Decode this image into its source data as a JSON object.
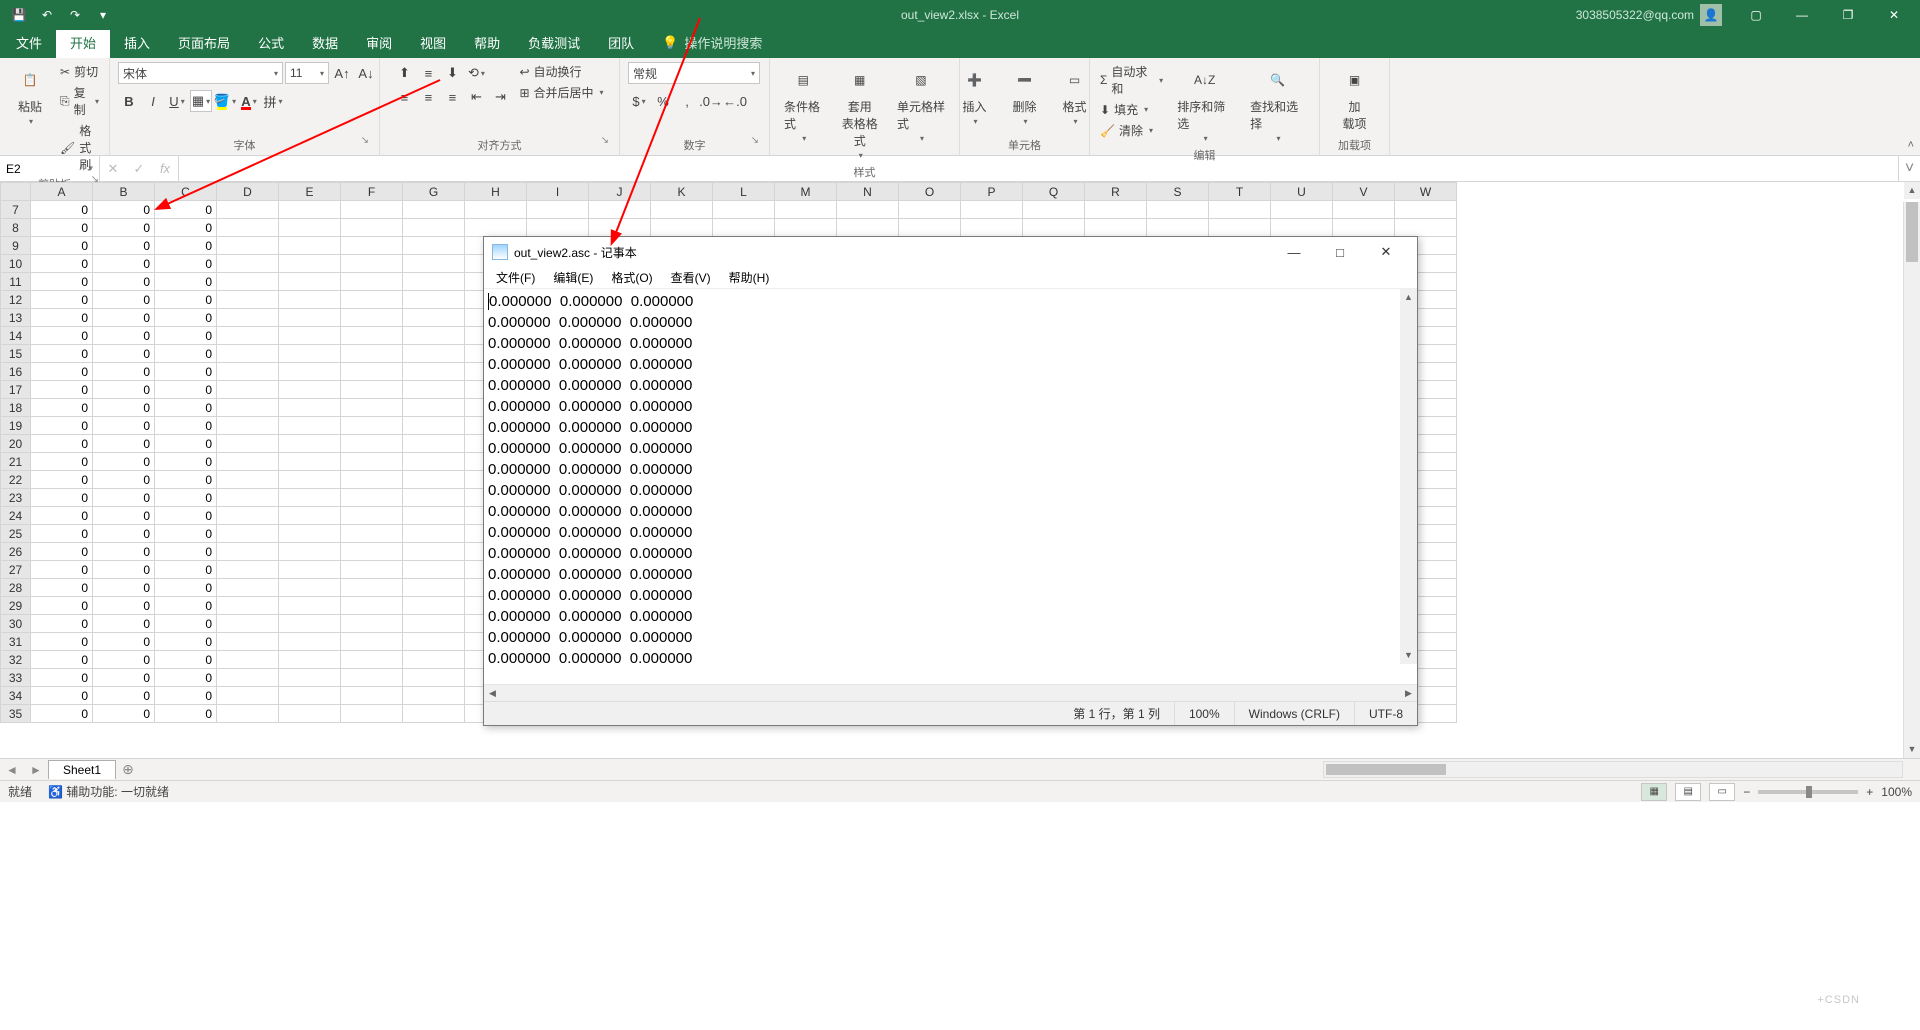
{
  "titlebar": {
    "doc_title": "out_view2.xlsx  -  Excel",
    "user_email": "3038505322@qq.com"
  },
  "tabs": {
    "file": "文件",
    "home": "开始",
    "insert": "插入",
    "layout": "页面布局",
    "formulas": "公式",
    "data": "数据",
    "review": "审阅",
    "view": "视图",
    "help": "帮助",
    "loadtest": "负载测试",
    "team": "团队",
    "tellme": "操作说明搜索"
  },
  "ribbon": {
    "clipboard": {
      "label": "剪贴板",
      "paste": "粘贴",
      "cut": "剪切",
      "copy": "复制",
      "painter": "格式刷"
    },
    "font": {
      "label": "字体",
      "name": "宋体",
      "size": "11"
    },
    "align": {
      "label": "对齐方式",
      "wrap": "自动换行",
      "merge": "合并后居中"
    },
    "number": {
      "label": "数字",
      "format": "常规"
    },
    "styles": {
      "label": "样式",
      "cond": "条件格式",
      "table": "套用\n表格格式",
      "cell": "单元格样式"
    },
    "cells": {
      "label": "单元格",
      "insert": "插入",
      "delete": "删除",
      "format": "格式"
    },
    "editing": {
      "label": "编辑",
      "sum": "自动求和",
      "fill": "填充",
      "clear": "清除",
      "sort": "排序和筛选",
      "find": "查找和选择"
    },
    "addins": {
      "label": "加载项",
      "btn": "加\n载项"
    }
  },
  "namebox": {
    "ref": "E2"
  },
  "columns": [
    "A",
    "B",
    "C",
    "D",
    "E",
    "F",
    "G",
    "H",
    "I",
    "J",
    "K",
    "L",
    "M",
    "N",
    "O",
    "P",
    "Q",
    "R",
    "S",
    "T",
    "U",
    "V",
    "W"
  ],
  "rows_start": 7,
  "rows_end": 35,
  "selected_cell": {
    "row": 2,
    "col": "E"
  },
  "data_cols": [
    "A",
    "B",
    "C"
  ],
  "cell_value": "0",
  "sheettabs": {
    "sheet1": "Sheet1"
  },
  "statusbar": {
    "ready": "就绪",
    "acc": "辅助功能: 一切就绪",
    "zoom": "100%"
  },
  "watermark": "+CSDN",
  "notepad": {
    "title": "out_view2.asc - 记事本",
    "menu": {
      "file": "文件(F)",
      "edit": "编辑(E)",
      "format": "格式(O)",
      "view": "查看(V)",
      "help": "帮助(H)"
    },
    "line": "0.000000  0.000000  0.000000",
    "line_count": 18,
    "status": {
      "pos": "第 1 行，第 1 列",
      "zoom": "100%",
      "eol": "Windows (CRLF)",
      "enc": "UTF-8"
    }
  }
}
